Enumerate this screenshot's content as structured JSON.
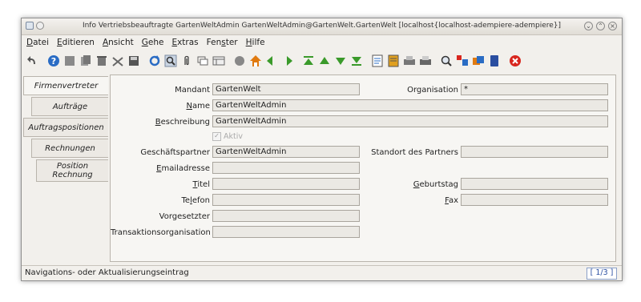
{
  "window": {
    "title": "Info Vertriebsbeauftragte  GartenWeltAdmin  GartenWeltAdmin@GartenWelt.GartenWelt [localhost{localhost-adempiere-adempiere}]"
  },
  "menu": [
    {
      "pre": "",
      "ul": "D",
      "post": "atei"
    },
    {
      "pre": "",
      "ul": "E",
      "post": "ditieren"
    },
    {
      "pre": "",
      "ul": "A",
      "post": "nsicht"
    },
    {
      "pre": "",
      "ul": "G",
      "post": "ehe"
    },
    {
      "pre": "",
      "ul": "E",
      "post": "xtras"
    },
    {
      "pre": "Fen",
      "ul": "s",
      "post": "ter"
    },
    {
      "pre": "",
      "ul": "H",
      "post": "ilfe"
    }
  ],
  "tabs": [
    {
      "label": "Firmenvertreter"
    },
    {
      "label": "Aufträge"
    },
    {
      "label": "Auftragspositionen"
    },
    {
      "label": "Rechnungen"
    },
    {
      "label": "Position\nRechnung"
    }
  ],
  "form": {
    "mandant": {
      "label": "Mandant",
      "value": "GartenWelt"
    },
    "organisation": {
      "label": "Organisation",
      "value": "*"
    },
    "name": {
      "label_ul": "N",
      "label_rest": "ame",
      "value": "GartenWeltAdmin"
    },
    "beschreibung": {
      "label_ul": "B",
      "label_rest": "eschreibung",
      "value": "GartenWeltAdmin"
    },
    "aktiv": {
      "label": "Aktiv",
      "checked": true
    },
    "geschaeftspartner": {
      "label": "Geschäftspartner",
      "value": "GartenWeltAdmin"
    },
    "standort": {
      "label": "Standort des Partners",
      "value": ""
    },
    "email": {
      "label_ul": "E",
      "label_rest": "mailadresse",
      "value": ""
    },
    "titel": {
      "label_ul": "T",
      "label_rest": "itel",
      "value": ""
    },
    "geburtstag": {
      "label_ul": "G",
      "label_rest": "eburtstag",
      "value": ""
    },
    "telefon": {
      "label_pre": "Te",
      "label_ul": "l",
      "label_rest": "efon",
      "value": ""
    },
    "fax": {
      "label_ul": "F",
      "label_rest": "ax",
      "value": ""
    },
    "vorgesetzter": {
      "label": "Vorgesetzter",
      "value": ""
    },
    "transaktionsorganisation": {
      "label": "Transaktionsorganisation",
      "value": ""
    }
  },
  "status": {
    "text": "Navigations- oder Aktualisierungseintrag",
    "record": "[ 1/3 ]"
  },
  "colors": {
    "accent_blue": "#2a6cc4",
    "green": "#3a9a2a",
    "red_close": "#d8261e",
    "orange_home": "#e07a10"
  }
}
